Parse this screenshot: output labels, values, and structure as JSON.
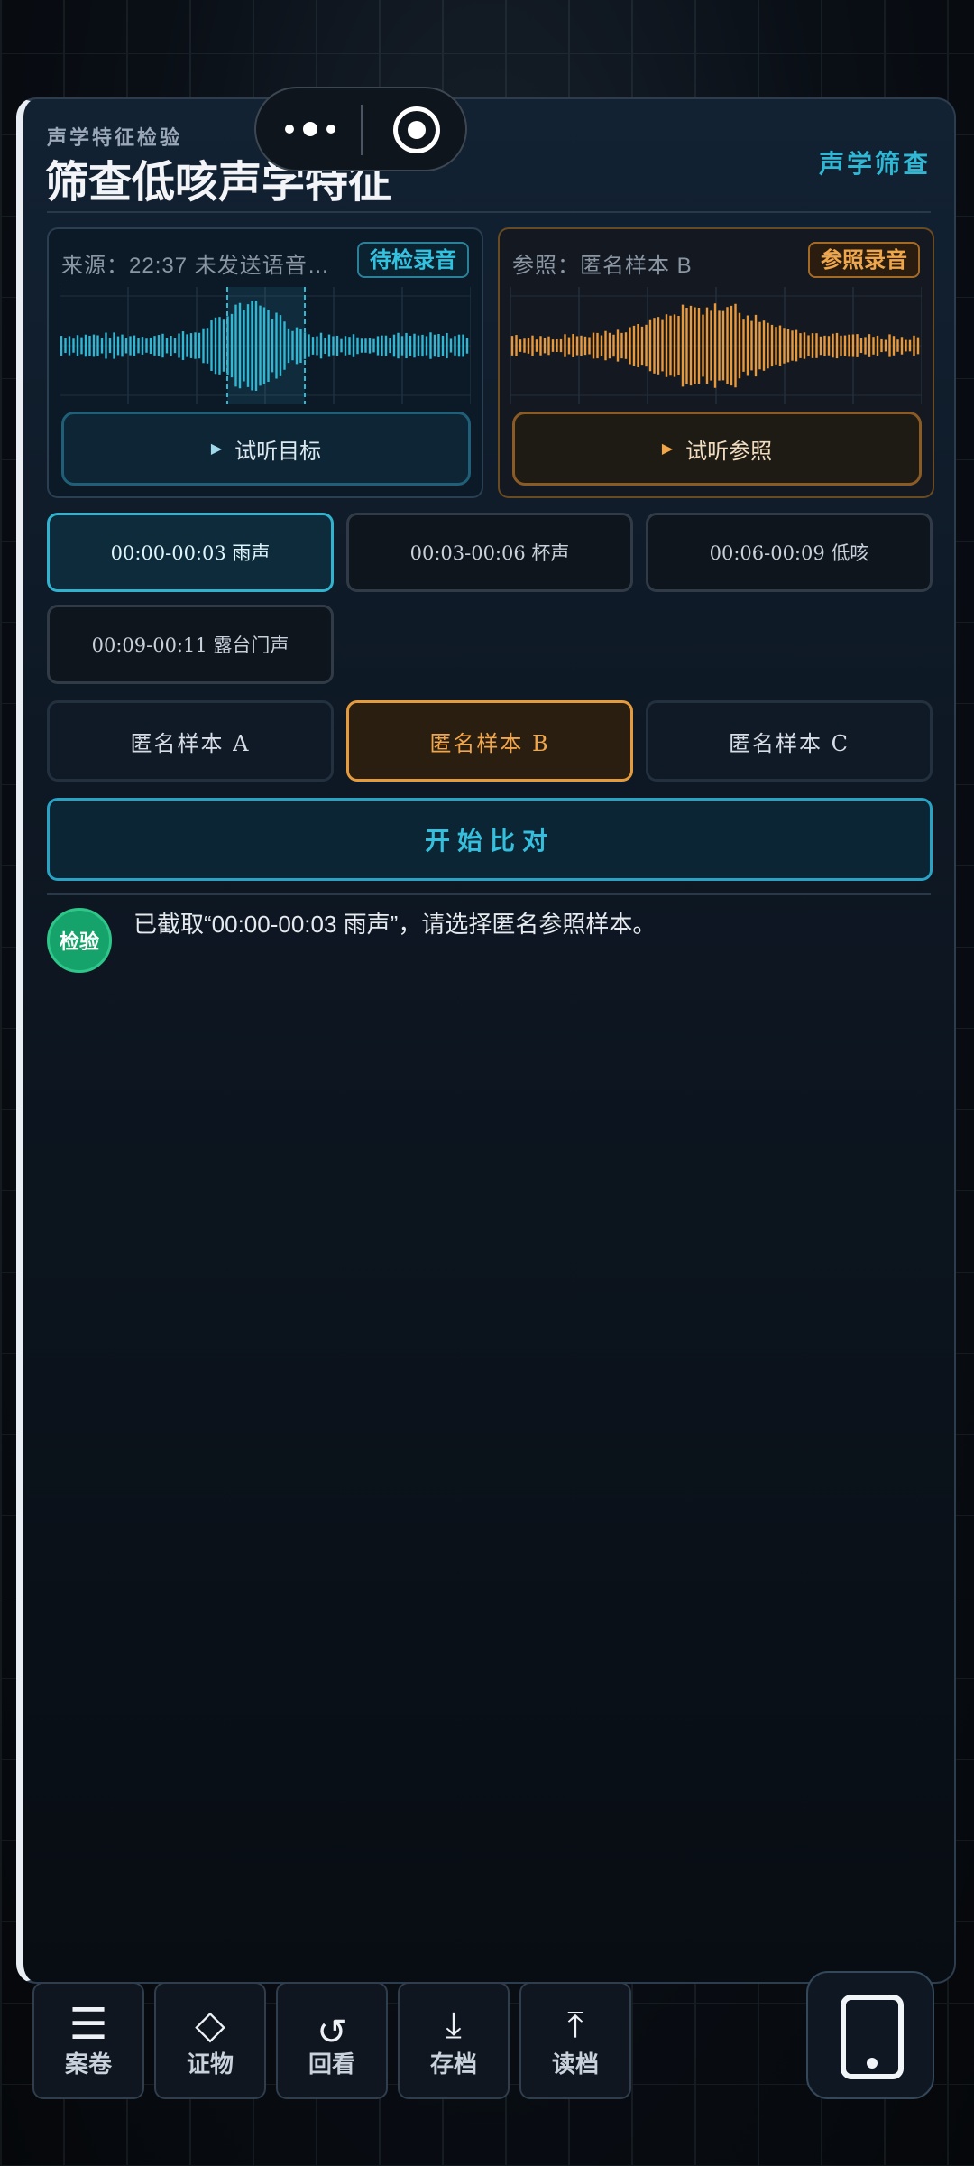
{
  "header": {
    "subtitle": "声学特征检验",
    "title": "筛查低咳声学特征",
    "tag": "声学筛查"
  },
  "target_card": {
    "source": "来源：22:37 未发送语音 …",
    "badge": "待检录音",
    "play_label": "试听目标",
    "accent_color": "#2fb7d4"
  },
  "reference_card": {
    "source": "参照：匿名样本 B",
    "badge": "参照录音",
    "play_label": "试听参照",
    "accent_color": "#e9983a"
  },
  "segments": [
    {
      "label": "00:00-00:03 雨声",
      "active": true
    },
    {
      "label": "00:03-00:06 杯声",
      "active": false
    },
    {
      "label": "00:06-00:09 低咳",
      "active": false
    },
    {
      "label": "00:09-00:11 露台门声",
      "active": false
    }
  ],
  "samples": [
    {
      "label": "匿名样本 A",
      "active": false
    },
    {
      "label": "匿名样本 B",
      "active": true
    },
    {
      "label": "匿名样本 C",
      "active": false
    }
  ],
  "start_button": "开始比对",
  "status": {
    "chip": "检验",
    "message": "已截取“00:00-00:03 雨声”，请选择匿名参照样本。"
  },
  "nav": [
    {
      "label": "案卷",
      "icon": "menu-icon"
    },
    {
      "label": "证物",
      "icon": "diamond-icon"
    },
    {
      "label": "回看",
      "icon": "replay-icon"
    },
    {
      "label": "存档",
      "icon": "save-icon"
    },
    {
      "label": "读档",
      "icon": "load-icon"
    }
  ]
}
